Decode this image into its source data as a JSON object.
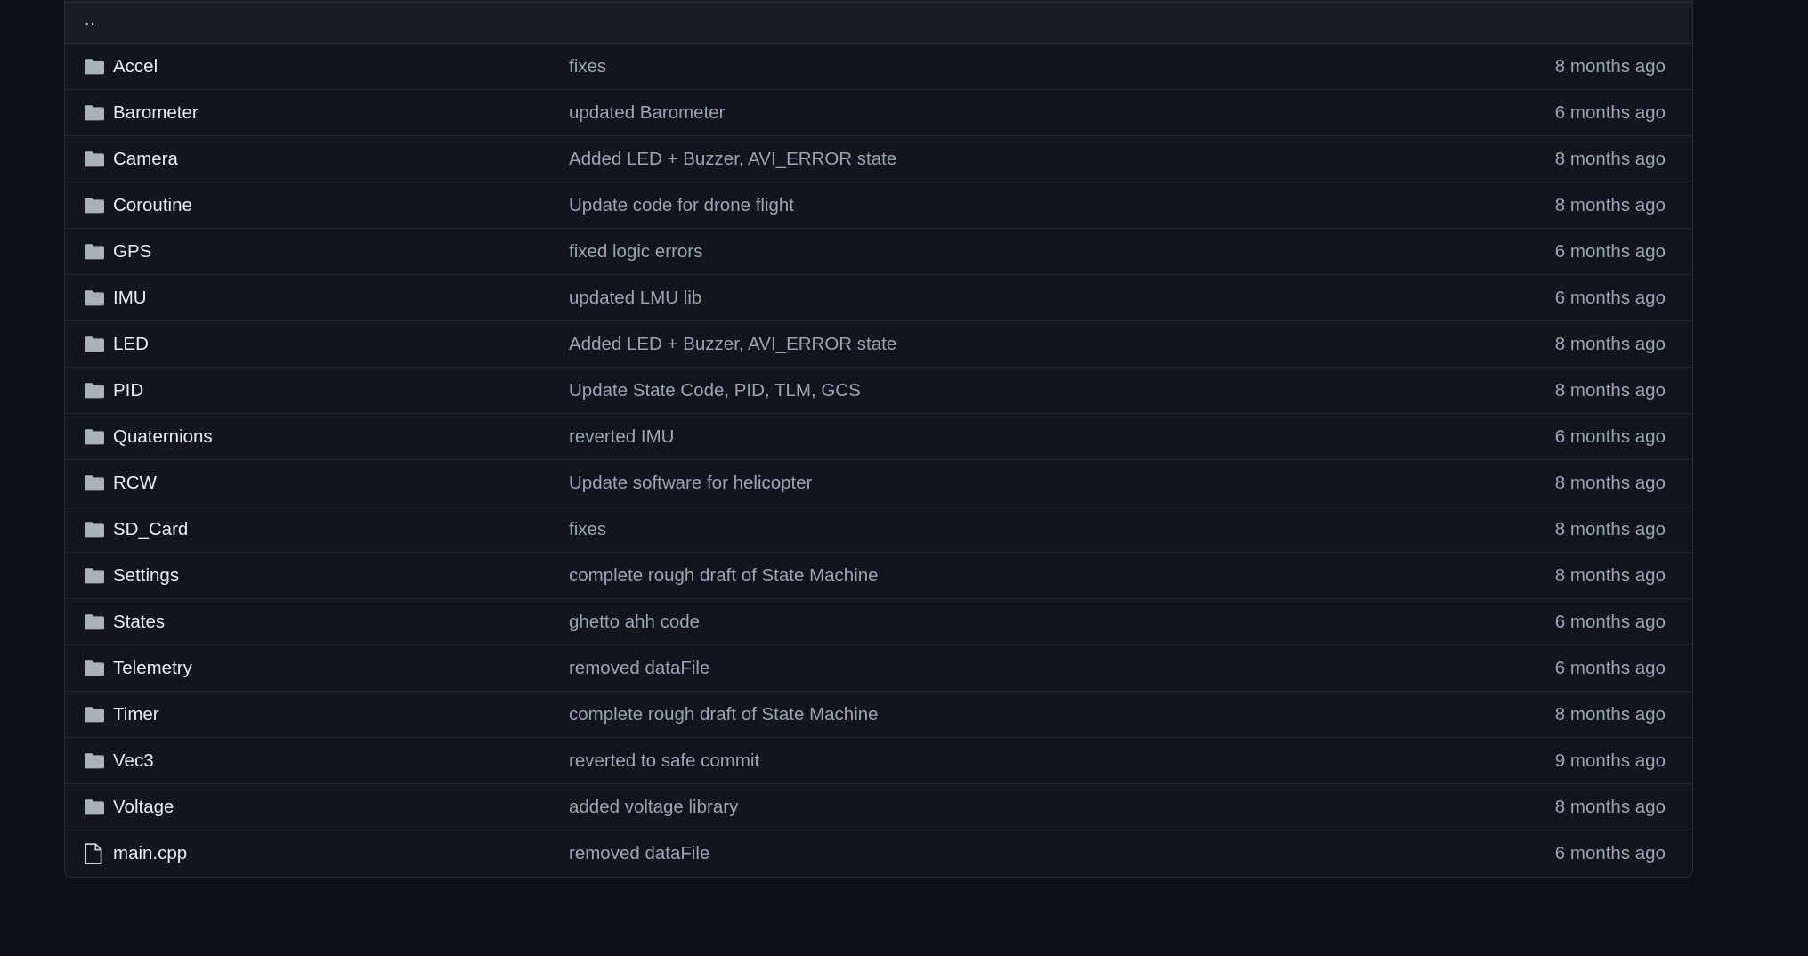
{
  "view": {
    "kind": "repository-file-browser",
    "background_color": "#0d1117",
    "row_background_color": "#12151d",
    "header_background_color": "#171c26",
    "border_color": "#262d38",
    "name_text_color": "#e6edf3",
    "muted_text_color": "#9aa4b2",
    "folder_icon_color": "#a9b1ba",
    "file_icon_color": "#c9d1d9"
  },
  "parent_row": {
    "label": "..",
    "icon": "parent-directory-link"
  },
  "columns": {
    "name": "",
    "message": "",
    "age": ""
  },
  "entries": [
    {
      "icon": "folder-icon",
      "type": "folder",
      "name": "Accel",
      "message": "fixes",
      "age": "8 months ago"
    },
    {
      "icon": "folder-icon",
      "type": "folder",
      "name": "Barometer",
      "message": "updated Barometer",
      "age": "6 months ago"
    },
    {
      "icon": "folder-icon",
      "type": "folder",
      "name": "Camera",
      "message": "Added LED + Buzzer, AVI_ERROR state",
      "age": "8 months ago"
    },
    {
      "icon": "folder-icon",
      "type": "folder",
      "name": "Coroutine",
      "message": "Update code for drone flight",
      "age": "8 months ago"
    },
    {
      "icon": "folder-icon",
      "type": "folder",
      "name": "GPS",
      "message": "fixed logic errors",
      "age": "6 months ago"
    },
    {
      "icon": "folder-icon",
      "type": "folder",
      "name": "IMU",
      "message": "updated LMU lib",
      "age": "6 months ago"
    },
    {
      "icon": "folder-icon",
      "type": "folder",
      "name": "LED",
      "message": "Added LED + Buzzer, AVI_ERROR state",
      "age": "8 months ago"
    },
    {
      "icon": "folder-icon",
      "type": "folder",
      "name": "PID",
      "message": "Update State Code, PID, TLM, GCS",
      "age": "8 months ago"
    },
    {
      "icon": "folder-icon",
      "type": "folder",
      "name": "Quaternions",
      "message": "reverted IMU",
      "age": "6 months ago"
    },
    {
      "icon": "folder-icon",
      "type": "folder",
      "name": "RCW",
      "message": "Update software for helicopter",
      "age": "8 months ago"
    },
    {
      "icon": "folder-icon",
      "type": "folder",
      "name": "SD_Card",
      "message": "fixes",
      "age": "8 months ago"
    },
    {
      "icon": "folder-icon",
      "type": "folder",
      "name": "Settings",
      "message": "complete rough draft of State Machine",
      "age": "8 months ago"
    },
    {
      "icon": "folder-icon",
      "type": "folder",
      "name": "States",
      "message": "ghetto ahh code",
      "age": "6 months ago"
    },
    {
      "icon": "folder-icon",
      "type": "folder",
      "name": "Telemetry",
      "message": "removed dataFile",
      "age": "6 months ago"
    },
    {
      "icon": "folder-icon",
      "type": "folder",
      "name": "Timer",
      "message": "complete rough draft of State Machine",
      "age": "8 months ago"
    },
    {
      "icon": "folder-icon",
      "type": "folder",
      "name": "Vec3",
      "message": "reverted to safe commit",
      "age": "9 months ago"
    },
    {
      "icon": "folder-icon",
      "type": "folder",
      "name": "Voltage",
      "message": "added voltage library",
      "age": "8 months ago"
    },
    {
      "icon": "file-icon",
      "type": "file",
      "name": "main.cpp",
      "message": "removed dataFile",
      "age": "6 months ago"
    }
  ]
}
